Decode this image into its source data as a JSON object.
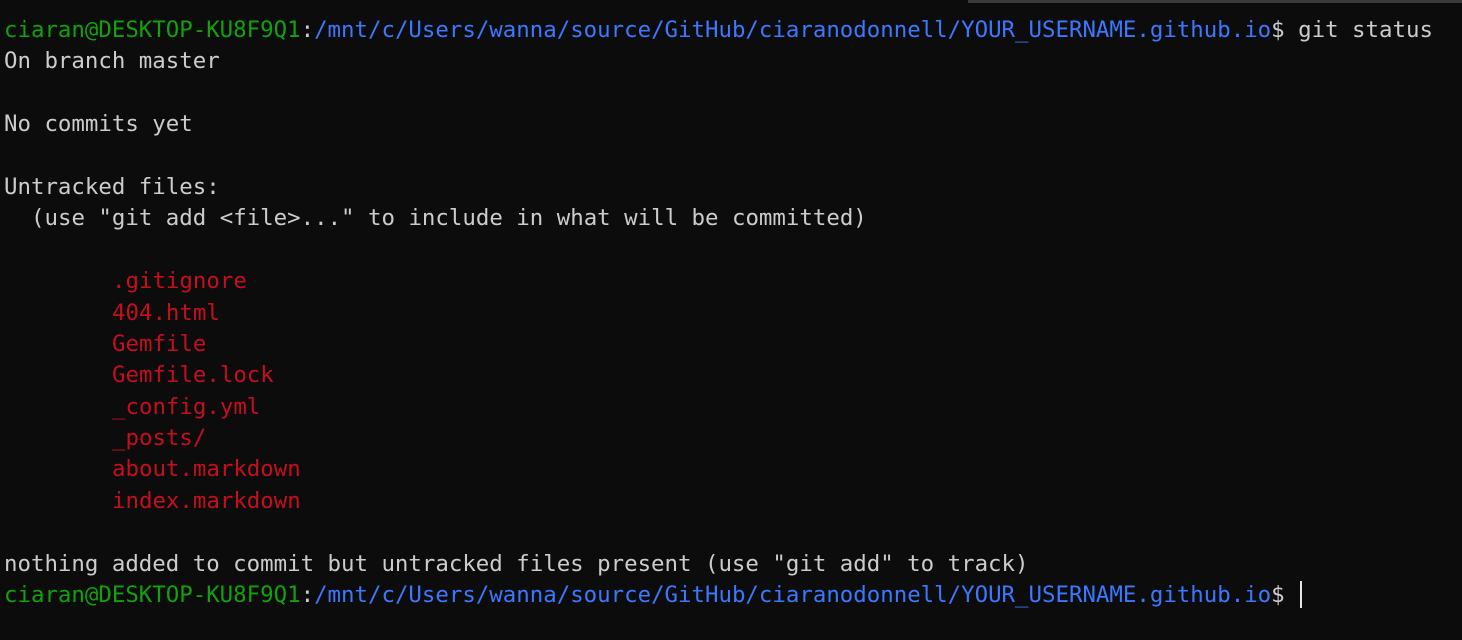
{
  "colors": {
    "background": "#0c0c0c",
    "foreground": "#cccccc",
    "user_host": "#13a10e",
    "path": "#3b78ff",
    "untracked_file": "#c50f1f"
  },
  "prompt": {
    "user_host": "ciaran@DESKTOP-KU8F9Q1",
    "separator": ":",
    "path": "/mnt/c/Users/wanna/source/GitHub/ciaranodonnell/YOUR_USERNAME.github.io",
    "symbol": "$"
  },
  "command": "git status",
  "output": {
    "branch_line": "On branch master",
    "commits_line": "No commits yet",
    "untracked_header": "Untracked files:",
    "untracked_hint": "(use \"git add <file>...\" to include in what will be committed)",
    "files": [
      ".gitignore",
      "404.html",
      "Gemfile",
      "Gemfile.lock",
      "_config.yml",
      "_posts/",
      "about.markdown",
      "index.markdown"
    ],
    "summary_line": "nothing added to commit but untracked files present (use \"git add\" to track)"
  }
}
